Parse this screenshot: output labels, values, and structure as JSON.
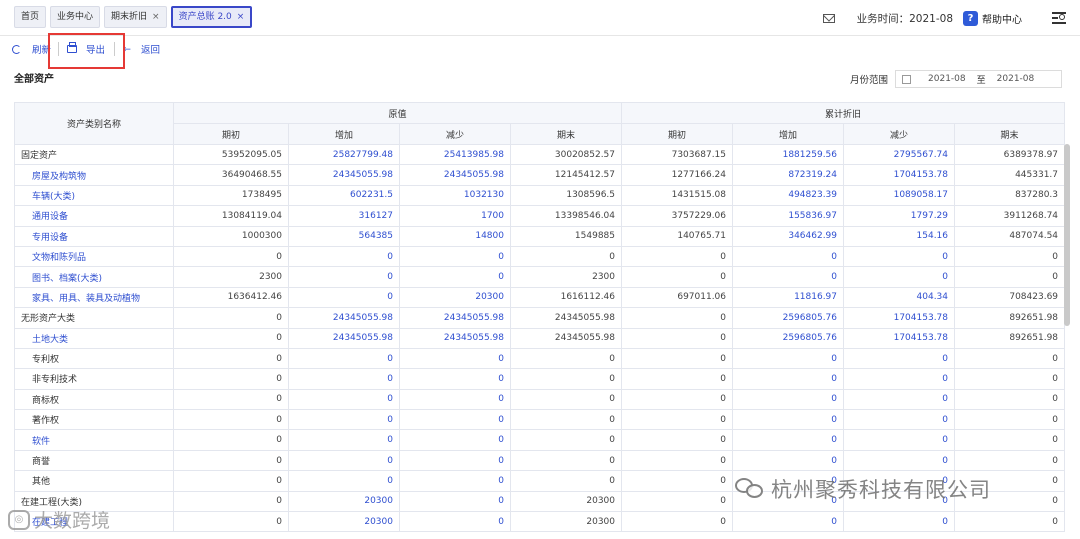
{
  "tabs": [
    {
      "label": "首页",
      "closable": false,
      "active": false
    },
    {
      "label": "业务中心",
      "closable": false,
      "active": false
    },
    {
      "label": "期末折旧",
      "closable": true,
      "active": false
    },
    {
      "label": "资产总账 2.0",
      "closable": true,
      "active": true
    }
  ],
  "header": {
    "business_time_label": "业务时间：",
    "business_time_value": "2021-08",
    "help_label": "帮助中心",
    "help_icon_glyph": "?"
  },
  "toolbar": {
    "refresh_label": "刷新",
    "export_label": "导出",
    "back_label": "返回",
    "back_glyph": "←"
  },
  "page": {
    "section_title": "全部资产",
    "month_range_label": "月份范围",
    "range_start": "2021-08",
    "range_sep": "至",
    "range_end": "2021-08"
  },
  "table": {
    "name_header": "资产类别名称",
    "group_original": "原值",
    "group_depreciation": "累计折旧",
    "sub_headers": [
      "期初",
      "增加",
      "减少",
      "期末",
      "期初",
      "增加",
      "减少",
      "期末"
    ],
    "rows": [
      {
        "name": "固定资产",
        "level": 0,
        "name_link": false,
        "values": [
          "53952095.05",
          "25827799.48",
          "25413985.98",
          "30020852.57",
          "7303687.15",
          "1881259.56",
          "2795567.74",
          "6389378.97"
        ]
      },
      {
        "name": "房屋及构筑物",
        "level": 1,
        "name_link": true,
        "values": [
          "36490468.55",
          "24345055.98",
          "24345055.98",
          "12145412.57",
          "1277166.24",
          "872319.24",
          "1704153.78",
          "445331.7"
        ]
      },
      {
        "name": "车辆(大类)",
        "level": 1,
        "name_link": true,
        "values": [
          "1738495",
          "602231.5",
          "1032130",
          "1308596.5",
          "1431515.08",
          "494823.39",
          "1089058.17",
          "837280.3"
        ]
      },
      {
        "name": "通用设备",
        "level": 1,
        "name_link": true,
        "values": [
          "13084119.04",
          "316127",
          "1700",
          "13398546.04",
          "3757229.06",
          "155836.97",
          "1797.29",
          "3911268.74"
        ]
      },
      {
        "name": "专用设备",
        "level": 1,
        "name_link": true,
        "values": [
          "1000300",
          "564385",
          "14800",
          "1549885",
          "140765.71",
          "346462.99",
          "154.16",
          "487074.54"
        ]
      },
      {
        "name": "文物和陈列品",
        "level": 1,
        "name_link": true,
        "values": [
          "0",
          "0",
          "0",
          "0",
          "0",
          "0",
          "0",
          "0"
        ]
      },
      {
        "name": "图书、档案(大类)",
        "level": 1,
        "name_link": true,
        "values": [
          "2300",
          "0",
          "0",
          "2300",
          "0",
          "0",
          "0",
          "0"
        ]
      },
      {
        "name": "家具、用具、装具及动植物",
        "level": 1,
        "name_link": true,
        "values": [
          "1636412.46",
          "0",
          "20300",
          "1616112.46",
          "697011.06",
          "11816.97",
          "404.34",
          "708423.69"
        ]
      },
      {
        "name": "无形资产大类",
        "level": 0,
        "name_link": false,
        "values": [
          "0",
          "24345055.98",
          "24345055.98",
          "24345055.98",
          "0",
          "2596805.76",
          "1704153.78",
          "892651.98"
        ]
      },
      {
        "name": "土地大类",
        "level": 1,
        "name_link": true,
        "values": [
          "0",
          "24345055.98",
          "24345055.98",
          "24345055.98",
          "0",
          "2596805.76",
          "1704153.78",
          "892651.98"
        ]
      },
      {
        "name": "专利权",
        "level": 1,
        "name_link": false,
        "values": [
          "0",
          "0",
          "0",
          "0",
          "0",
          "0",
          "0",
          "0"
        ]
      },
      {
        "name": "非专利技术",
        "level": 1,
        "name_link": false,
        "values": [
          "0",
          "0",
          "0",
          "0",
          "0",
          "0",
          "0",
          "0"
        ]
      },
      {
        "name": "商标权",
        "level": 1,
        "name_link": false,
        "values": [
          "0",
          "0",
          "0",
          "0",
          "0",
          "0",
          "0",
          "0"
        ]
      },
      {
        "name": "著作权",
        "level": 1,
        "name_link": false,
        "values": [
          "0",
          "0",
          "0",
          "0",
          "0",
          "0",
          "0",
          "0"
        ]
      },
      {
        "name": "软件",
        "level": 1,
        "name_link": true,
        "values": [
          "0",
          "0",
          "0",
          "0",
          "0",
          "0",
          "0",
          "0"
        ]
      },
      {
        "name": "商誉",
        "level": 1,
        "name_link": false,
        "values": [
          "0",
          "0",
          "0",
          "0",
          "0",
          "0",
          "0",
          "0"
        ]
      },
      {
        "name": "其他",
        "level": 1,
        "name_link": false,
        "values": [
          "0",
          "0",
          "0",
          "0",
          "0",
          "0",
          "0",
          "0"
        ]
      },
      {
        "name": "在建工程(大类)",
        "level": 0,
        "name_link": false,
        "values": [
          "0",
          "20300",
          "0",
          "20300",
          "0",
          "0",
          "0",
          "0"
        ]
      },
      {
        "name": "在建工程",
        "level": 1,
        "name_link": true,
        "values": [
          "0",
          "20300",
          "0",
          "20300",
          "0",
          "0",
          "0",
          "0"
        ]
      }
    ]
  },
  "watermarks": {
    "right_text": "杭州聚秀科技有限公司",
    "left_text": "大数跨境"
  }
}
